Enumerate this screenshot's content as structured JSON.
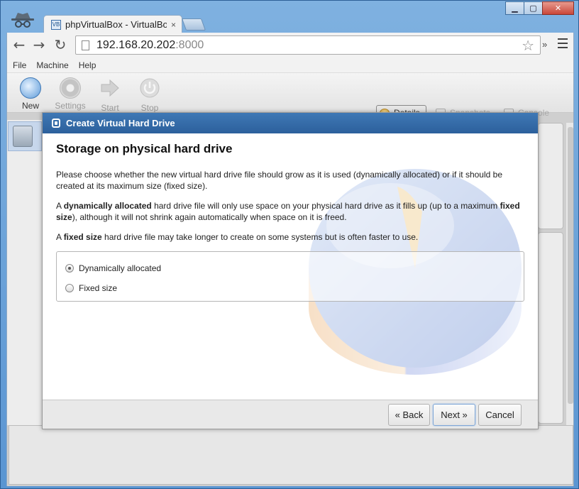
{
  "browser": {
    "tab_title": "phpVirtualBox - VirtualBox",
    "tab_close": "×",
    "url_host": "192.168.20.202",
    "url_port": ":8000",
    "ext_label": "»"
  },
  "menubar": {
    "items": [
      "File",
      "Machine",
      "Help"
    ]
  },
  "toolbar": {
    "new_label": "New",
    "settings_label": "Settings",
    "start_label": "Start",
    "stop_label": "Stop",
    "details_label": "Details",
    "snapshots_label": "Snapshots",
    "console_label": "Console"
  },
  "dialog": {
    "title": "Create Virtual Hard Drive",
    "heading": "Storage on physical hard drive",
    "para1": "Please choose whether the new virtual hard drive file should grow as it is used (dynamically allocated) or if it should be created at its maximum size (fixed size).",
    "para2_a": "A ",
    "para2_b1": "dynamically allocated",
    "para2_b": " hard drive file will only use space on your physical hard drive as it fills up (up to a maximum ",
    "para2_b2": "fixed size",
    "para2_c": "), although it will not shrink again automatically when space on it is freed.",
    "para3_a": "A ",
    "para3_b1": "fixed size",
    "para3_b": " hard drive file may take longer to create on some systems but is often faster to use.",
    "options": [
      {
        "label": "Dynamically allocated",
        "selected": true
      },
      {
        "label": "Fixed size",
        "selected": false
      }
    ],
    "back_label": "« Back",
    "next_label": "Next »",
    "cancel_label": "Cancel"
  }
}
